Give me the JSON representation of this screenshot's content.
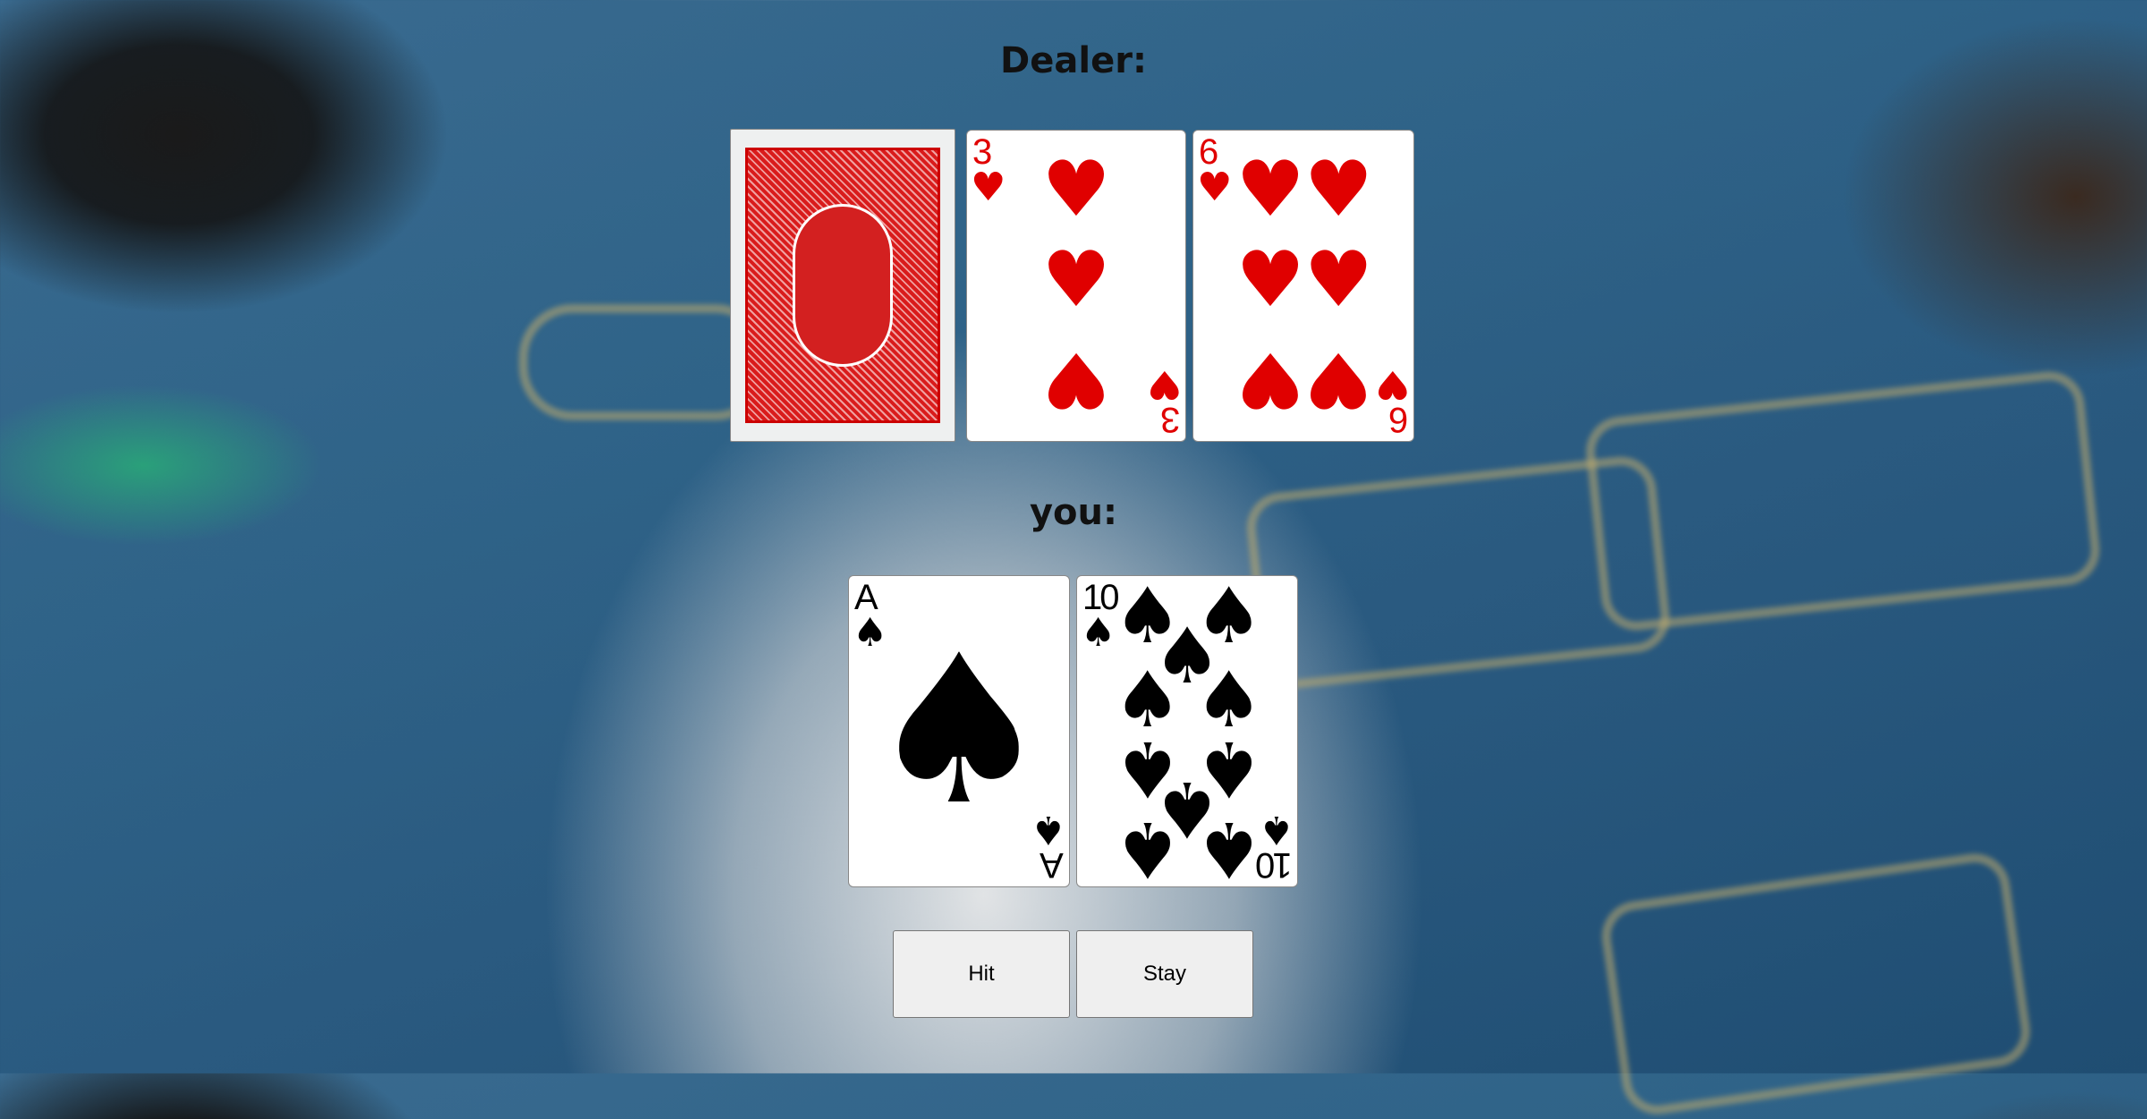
{
  "dealer": {
    "label": "Dealer:",
    "cards": [
      {
        "face": "down"
      },
      {
        "rank": "3",
        "suit": "hearts",
        "symbol": "♥",
        "color": "#e00000"
      },
      {
        "rank": "6",
        "suit": "hearts",
        "symbol": "♥",
        "color": "#e00000"
      }
    ]
  },
  "player": {
    "label": "you:",
    "cards": [
      {
        "rank": "A",
        "suit": "spades",
        "symbol": "♠",
        "color": "#000000"
      },
      {
        "rank": "10",
        "suit": "spades",
        "symbol": "♠",
        "color": "#000000"
      }
    ]
  },
  "controls": {
    "hit": "Hit",
    "stay": "Stay"
  }
}
